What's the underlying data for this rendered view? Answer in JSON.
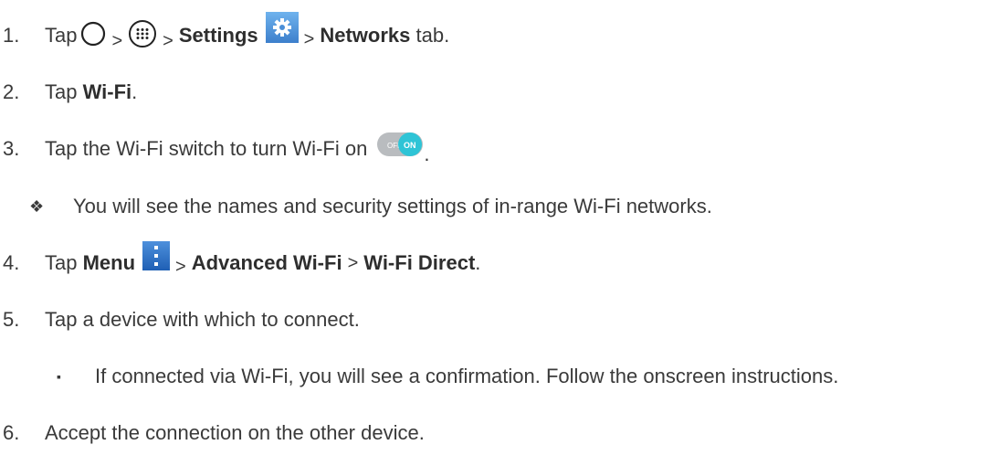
{
  "steps": [
    {
      "num": "1.",
      "tap": "Tap",
      "sep1": ">",
      "sep2": ">",
      "settings": "Settings",
      "sep3": ">",
      "networks": "Networks",
      "tab": " tab."
    },
    {
      "num": "2.",
      "tap": "Tap ",
      "wifi": "Wi-Fi",
      "end": "."
    },
    {
      "num": "3.",
      "text": "Tap the Wi-Fi switch to turn Wi-Fi on",
      "end": "."
    },
    {
      "bullet": "❖",
      "text": "You will see the names and security settings of in-range Wi-Fi networks."
    },
    {
      "num": "4.",
      "tap": "Tap ",
      "menu": "Menu",
      "sep1": ">",
      "advanced": "Advanced Wi-Fi",
      "sep2": ">",
      "direct": "Wi-Fi Direct",
      "end": "."
    },
    {
      "num": "5.",
      "text": "Tap a device with which to connect."
    },
    {
      "bullet": "▪",
      "text": "If connected via Wi-Fi, you will see a confirmation. Follow the onscreen instructions."
    },
    {
      "num": "6.",
      "text": "Accept the connection on the other device."
    }
  ],
  "toggle": {
    "off_label": "OFF",
    "on_label": "ON"
  },
  "icons": [
    "home-circle-icon",
    "apps-grid-icon",
    "settings-gear-icon",
    "wifi-toggle-icon",
    "menu-dots-icon"
  ],
  "colors": {
    "settings_icon": "#4a8fd8",
    "toggle_on": "#2ec4d6",
    "toggle_off": "#b9bcbf",
    "menu_icon": "#2a6fc4"
  }
}
